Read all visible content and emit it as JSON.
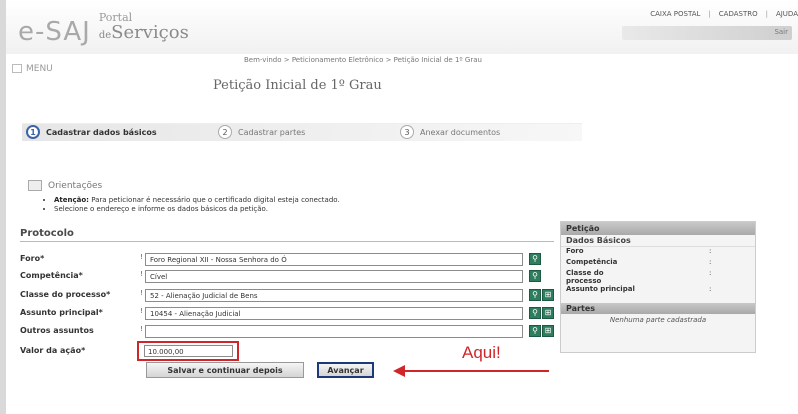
{
  "header": {
    "logo_mark": "e-SAJ",
    "logo_line1": "Portal",
    "logo_line2_small": "de",
    "logo_line2": "Serviços",
    "top_links": [
      "CAIXA POSTAL",
      "CADASTRO",
      "AJUDA"
    ],
    "user_text": "Sair"
  },
  "breadcrumb": "Bem-vindo > Peticionamento Eletrônico > Petição Inicial de 1º Grau",
  "menu_label": "MENU",
  "page_title": "Petição Inicial de 1º Grau",
  "steps": [
    {
      "num": "1",
      "label": "Cadastrar dados básicos"
    },
    {
      "num": "2",
      "label": "Cadastrar partes"
    },
    {
      "num": "3",
      "label": "Anexar documentos"
    }
  ],
  "orientations": {
    "title": "Orientações",
    "item1_bold": "Atenção:",
    "item1_text": " Para peticionar é necessário que o certificado digital esteja conectado.",
    "item2_text": "Selecione o endereço e informe os dados básicos da petição."
  },
  "protocol": {
    "title": "Protocolo",
    "fields": {
      "foro": {
        "label": "Foro*",
        "value": "Foro Regional XII - Nossa Senhora do Ó"
      },
      "competencia": {
        "label": "Competência*",
        "value": "Cível"
      },
      "classe": {
        "label": "Classe do processo*",
        "value": "52 - Alienação Judicial de Bens"
      },
      "assunto": {
        "label": "Assunto principal*",
        "value": "10454 - Alienação Judicial"
      },
      "outros": {
        "label": "Outros assuntos",
        "value": ""
      },
      "valor": {
        "label": "Valor da ação*",
        "value": "10.000,00"
      }
    },
    "tick": "!"
  },
  "buttons": {
    "save": "Salvar e continuar depois",
    "next": "Avançar"
  },
  "annotation": "Aqui!",
  "panel": {
    "title": "Petição",
    "subtitle": "Dados Básicos",
    "rows": [
      {
        "label": "Foro",
        "colon": ":"
      },
      {
        "label": "Competência",
        "colon": ":"
      },
      {
        "label": "Classe do processo",
        "colon": ":"
      },
      {
        "label": "Assunto principal",
        "colon": ":"
      }
    ],
    "parties_title": "Partes",
    "parties_empty": "Nenhuma parte cadastrada"
  },
  "colors": {
    "accent": "#3c63a8",
    "highlight": "#d0262a",
    "lookup_button": "#2f7d5f"
  }
}
